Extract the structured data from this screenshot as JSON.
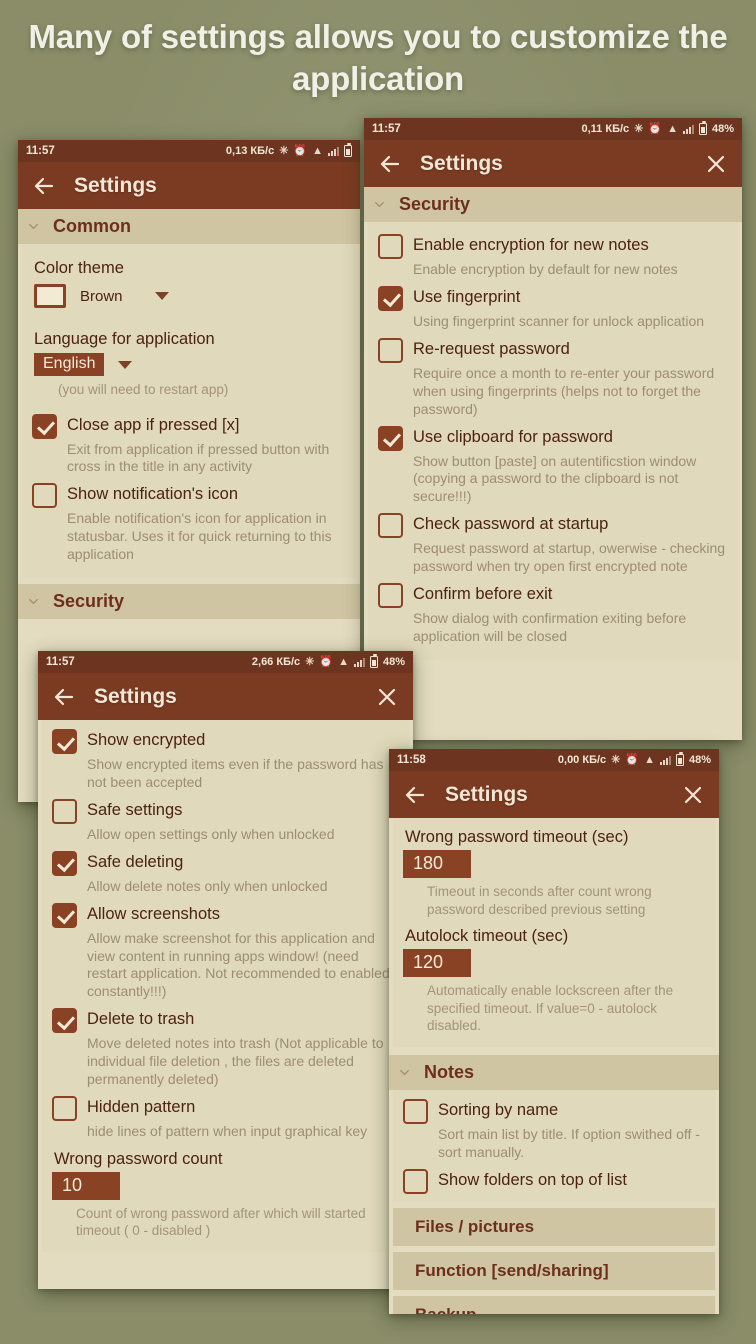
{
  "headline": "Many of settings allows you to customize the application",
  "theme": {
    "background": "#8a8d68",
    "statusbar_bg": "#6d3520",
    "appbar_bg": "#7a3b22",
    "panel_bg": "#e3dcc0",
    "group_header_bg": "#cfc5a3",
    "accent": "#8a4224",
    "title_text": "#4d2113",
    "subtitle_text": "#9d8d72"
  },
  "panels": [
    {
      "id": "panel-common",
      "statusbar": {
        "time": "11:57",
        "traffic": "0,13 КБ/c",
        "battery": ""
      },
      "appbar": {
        "title": "Settings",
        "back_icon": "arrow-left-icon",
        "close_icon": "close-icon"
      },
      "groups": [
        {
          "label": "Common",
          "items": [
            {
              "type": "select",
              "label": "Color theme",
              "value": "Brown"
            },
            {
              "type": "select",
              "label": "Language for application",
              "value": "English",
              "hint": "(you will need to restart app)"
            },
            {
              "type": "checkbox",
              "checked": true,
              "title": "Close app if pressed [x]",
              "sub": "Exit from application if pressed button with cross in the title in any activity"
            },
            {
              "type": "checkbox",
              "checked": false,
              "title": "Show notification's icon",
              "sub": "Enable notification's icon for application in statusbar. Uses it for quick returning to this application"
            }
          ]
        },
        {
          "label": "Security",
          "items": []
        }
      ]
    },
    {
      "id": "panel-security",
      "statusbar": {
        "time": "11:57",
        "traffic": "0,11 КБ/c",
        "battery": "48%"
      },
      "appbar": {
        "title": "Settings",
        "back_icon": "arrow-left-icon",
        "close_icon": "close-icon"
      },
      "groups": [
        {
          "label": "Security",
          "items": [
            {
              "type": "checkbox",
              "checked": false,
              "title": "Enable encryption for new notes",
              "sub": "Enable encryption by default for new notes"
            },
            {
              "type": "checkbox",
              "checked": true,
              "title": "Use fingerprint",
              "sub": "Using fingerprint scanner for unlock application"
            },
            {
              "type": "checkbox",
              "checked": false,
              "title": "Re-request password",
              "sub": "Require once a month to re-enter your password when using fingerprints (helps not to forget the password)"
            },
            {
              "type": "checkbox",
              "checked": true,
              "title": "Use clipboard for password",
              "sub": "Show button [paste] on autentificstion window (copying a password to the clipboard is not secure!!!)"
            },
            {
              "type": "checkbox",
              "checked": false,
              "title": "Check password at startup",
              "sub": "Request password at startup, owerwise - checking password when try open first encrypted note"
            },
            {
              "type": "checkbox",
              "checked": false,
              "title": "Confirm before exit",
              "sub": "Show dialog with confirmation exiting before application will be closed"
            }
          ]
        }
      ]
    },
    {
      "id": "panel-security-2",
      "statusbar": {
        "time": "11:57",
        "traffic": "2,66 КБ/c",
        "battery": "48%"
      },
      "appbar": {
        "title": "Settings",
        "back_icon": "arrow-left-icon",
        "close_icon": "close-icon"
      },
      "groups": [
        {
          "label": "",
          "items": [
            {
              "type": "checkbox",
              "checked": true,
              "title": "Show encrypted",
              "sub": "Show encrypted items even if the password has not been accepted"
            },
            {
              "type": "checkbox",
              "checked": false,
              "title": "Safe settings",
              "sub": "Allow open settings only when unlocked"
            },
            {
              "type": "checkbox",
              "checked": true,
              "title": "Safe deleting",
              "sub": "Allow delete notes only when unlocked"
            },
            {
              "type": "checkbox",
              "checked": true,
              "title": "Allow screenshots",
              "sub": "Allow make screenshot for this application and view content in running apps window! (need restart application. Not recommended to enabled constantly!!!)"
            },
            {
              "type": "checkbox",
              "checked": true,
              "title": "Delete to trash",
              "sub": "Move deleted notes into trash (Not applicable to individual file deletion , the files are deleted permanently deleted)"
            },
            {
              "type": "checkbox",
              "checked": false,
              "title": "Hidden pattern",
              "sub": "hide lines of pattern when input graphical key"
            },
            {
              "type": "value",
              "label": "Wrong password count",
              "value": "10",
              "hint": "Count of wrong password after which will started timeout ( 0 - disabled )"
            }
          ]
        }
      ]
    },
    {
      "id": "panel-notes",
      "statusbar": {
        "time": "11:58",
        "traffic": "0,00 КБ/c",
        "battery": "48%"
      },
      "appbar": {
        "title": "Settings",
        "back_icon": "arrow-left-icon",
        "close_icon": "close-icon"
      },
      "groups": [
        {
          "label": "",
          "items": [
            {
              "type": "value",
              "label": "Wrong password timeout (sec)",
              "value": "180",
              "hint": "Timeout in seconds after count wrong password described previous setting"
            },
            {
              "type": "value",
              "label": "Autolock timeout (sec)",
              "value": "120",
              "hint": "Automatically enable lockscreen after the specified timeout. If value=0 - autolock disabled."
            }
          ]
        },
        {
          "label": "Notes",
          "items": [
            {
              "type": "checkbox",
              "checked": false,
              "title": "Sorting by name",
              "sub": "Sort main list by title. If option swithed off - sort manually."
            },
            {
              "type": "checkbox",
              "checked": false,
              "title": "Show folders on top of list",
              "sub": ""
            }
          ]
        }
      ],
      "collapsed": [
        {
          "label": "Files / pictures"
        },
        {
          "label": "Function [send/sharing]"
        },
        {
          "label": "Backup"
        }
      ]
    }
  ]
}
